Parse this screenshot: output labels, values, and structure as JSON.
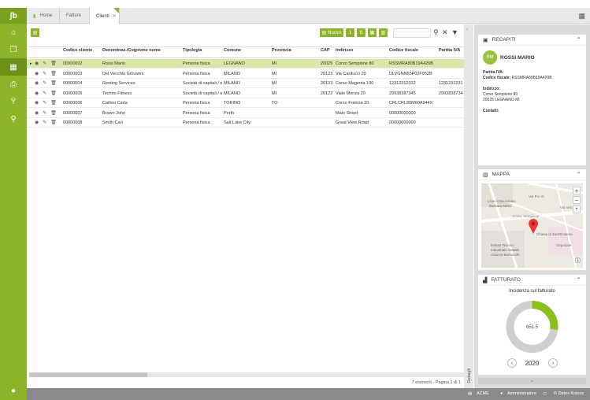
{
  "tabs": [
    {
      "label": "Home"
    },
    {
      "label": "Fatture"
    },
    {
      "label": "Clienti"
    }
  ],
  "toolbar": {
    "nuovo_label": "Nuovo",
    "search_placeholder": ""
  },
  "table": {
    "columns": [
      "Codice cliente",
      "Denominaz./Cognome nome",
      "Tipologia",
      "Comune",
      "Provincia",
      "CAP",
      "Indirizzo",
      "Codice fiscale",
      "Partita IVA"
    ],
    "rows": [
      [
        "00000002",
        "Rossi Mario",
        "Persona fisica",
        "LEGNANO",
        "MI",
        "20025",
        "Corso Sempione 80",
        "RSSMRA80B19A429B",
        ""
      ],
      [
        "00000003",
        "Del Vecchio Giovanni",
        "Persona fisica",
        "MILANO",
        "MI",
        "20123",
        "Via Carducci 20",
        "DLVGNN65P02F952B",
        ""
      ],
      [
        "00000004",
        "Renting Services",
        "Società di capitali / en",
        "MILANO",
        "MI",
        "20123",
        "Corso Magenta 100",
        "12312312312",
        "1231231231"
      ],
      [
        "00000005",
        "Techno Fitness",
        "Società di capitali / en",
        "MILANO",
        "MI",
        "20122",
        "Viale Monza 20",
        "29938387345",
        "2993838734"
      ],
      [
        "00000006",
        "Carlesi Carla",
        "Persona fisica",
        "TORINO",
        "TO",
        "",
        "Corso Francia 20",
        "CRLCRL80M60A944X",
        ""
      ],
      [
        "00000007",
        "Brown John",
        "Persona fisica",
        "Perth",
        "",
        "",
        "Main Street",
        "00000000000",
        ""
      ],
      [
        "00000008",
        "Smith Carl",
        "Persona fisica",
        "Salt Lake City",
        "",
        "",
        "Great View Road",
        "00000000000",
        ""
      ]
    ],
    "pager": "7 elementi - Pagina 1 di 1"
  },
  "detail_strip": "Dettagli",
  "recapiti": {
    "title": "RECAPITI",
    "initials": "RM",
    "name": "ROSSI MARIO",
    "piva_label": "Partita IVA:",
    "cf_label": "Codice fiscale:",
    "cf_value": "RSSMRA80B19A429B",
    "addr_label": "Indirizzo:",
    "addr_line1": "Corso Sempione 80",
    "addr_line2": "20025 LEGNANO MI",
    "contatti_label": "Contatti:"
  },
  "mappa": {
    "title": "MAPPA",
    "labels": [
      "Via Pio XI",
      "Liceo Canossiano",
      "Barbara Melzi",
      "Corso Sempione",
      "Via Verdi",
      "Chiesa di Sant'Erasmo",
      "Ospedale",
      "Istituto Tecnico",
      "Industriale Statale",
      "Antonio Bernocchi"
    ]
  },
  "fatturato": {
    "title": "FATTURATO",
    "chart_title": "Incidenza sul fatturato",
    "center_value": "651.5",
    "year": "2020"
  },
  "chart_data": {
    "type": "pie",
    "title": "Incidenza sul fatturato",
    "slices": [
      {
        "label": "selected",
        "value": 0.27,
        "color": "#8bbf1e"
      },
      {
        "label": "rest",
        "value": 0.73,
        "color": "#cfcfcf"
      }
    ],
    "center_label": "651.5"
  },
  "statusbar": {
    "company": "ACME",
    "user": "Amministratore",
    "copyright": "© Datev Koinos"
  },
  "colors": {
    "accent": "#8db32a",
    "selected_row": "#d8e8a8"
  }
}
